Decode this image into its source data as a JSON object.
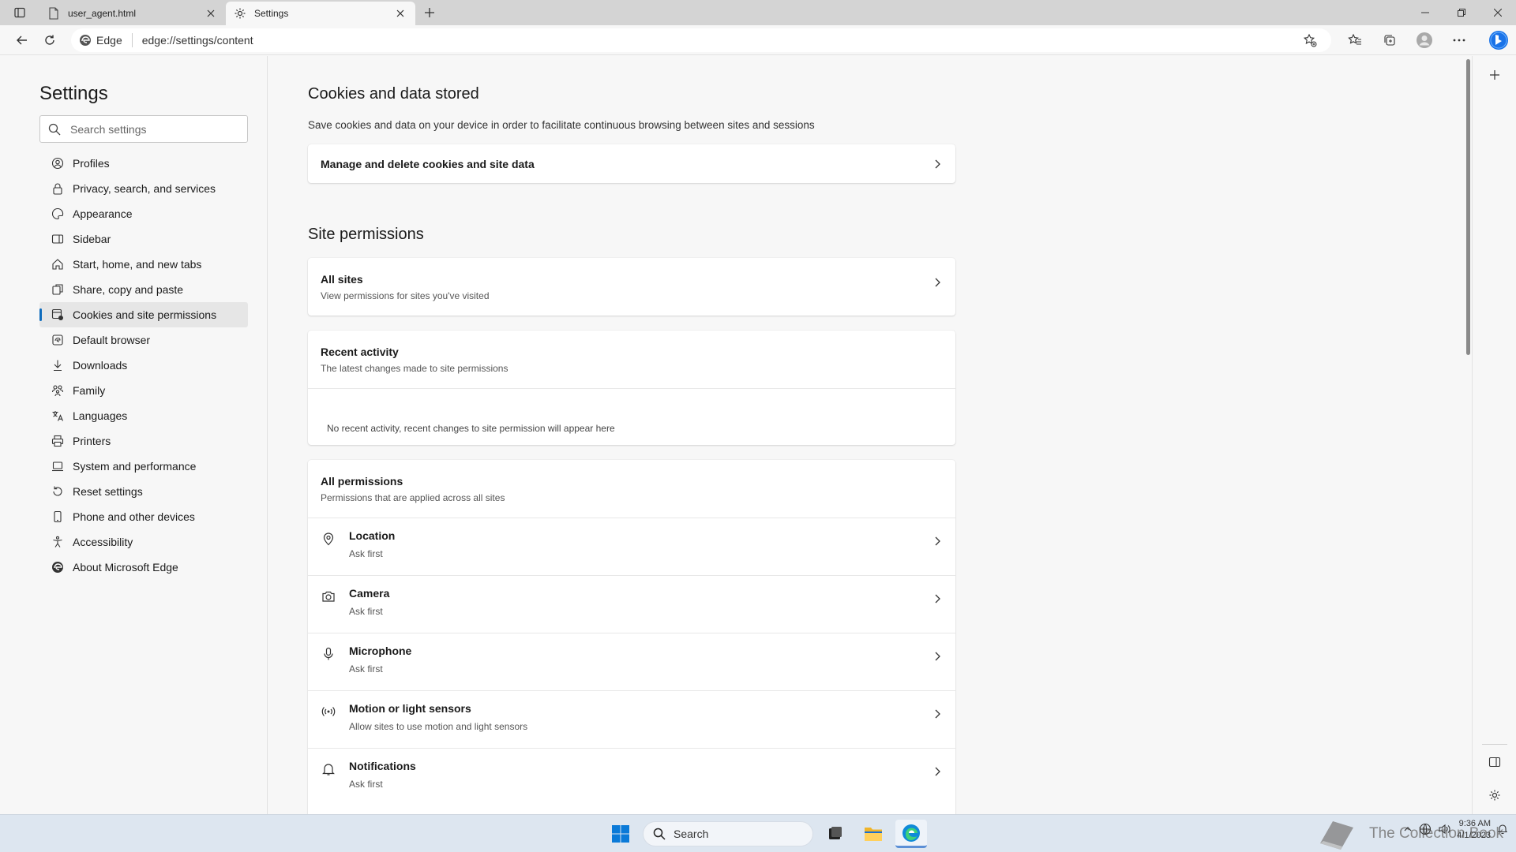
{
  "browser": {
    "tabs": [
      {
        "title": "user_agent.html",
        "icon": "file-icon"
      },
      {
        "title": "Settings",
        "icon": "gear-icon"
      }
    ],
    "edge_label": "Edge",
    "url": "edge://settings/content"
  },
  "sidebar": {
    "title": "Settings",
    "search_placeholder": "Search settings",
    "items": [
      {
        "label": "Profiles"
      },
      {
        "label": "Privacy, search, and services"
      },
      {
        "label": "Appearance"
      },
      {
        "label": "Sidebar"
      },
      {
        "label": "Start, home, and new tabs"
      },
      {
        "label": "Share, copy and paste"
      },
      {
        "label": "Cookies and site permissions"
      },
      {
        "label": "Default browser"
      },
      {
        "label": "Downloads"
      },
      {
        "label": "Family"
      },
      {
        "label": "Languages"
      },
      {
        "label": "Printers"
      },
      {
        "label": "System and performance"
      },
      {
        "label": "Reset settings"
      },
      {
        "label": "Phone and other devices"
      },
      {
        "label": "Accessibility"
      },
      {
        "label": "About Microsoft Edge"
      }
    ],
    "selected": "Cookies and site permissions"
  },
  "main": {
    "cookies": {
      "heading": "Cookies and data stored",
      "description": "Save cookies and data on your device in order to facilitate continuous browsing between sites and sessions",
      "manage_label": "Manage and delete cookies and site data"
    },
    "site_permissions": {
      "heading": "Site permissions",
      "all_sites": {
        "title": "All sites",
        "subtitle": "View permissions for sites you've visited"
      },
      "recent_activity": {
        "title": "Recent activity",
        "subtitle": "The latest changes made to site permissions",
        "empty": "No recent activity, recent changes to site permission will appear here"
      },
      "all_permissions": {
        "title": "All permissions",
        "subtitle": "Permissions that are applied across all sites",
        "items": [
          {
            "title": "Location",
            "subtitle": "Ask first",
            "icon": "location-icon"
          },
          {
            "title": "Camera",
            "subtitle": "Ask first",
            "icon": "camera-icon"
          },
          {
            "title": "Microphone",
            "subtitle": "Ask first",
            "icon": "microphone-icon"
          },
          {
            "title": "Motion or light sensors",
            "subtitle": "Allow sites to use motion and light sensors",
            "icon": "sensors-icon"
          },
          {
            "title": "Notifications",
            "subtitle": "Ask first",
            "icon": "bell-icon"
          }
        ]
      }
    }
  },
  "taskbar": {
    "search_label": "Search",
    "time": "9:36 AM",
    "date": "4/1/2023",
    "watermark": "The Collection Book"
  },
  "colors": {
    "accent": "#0f6cbd",
    "background": "#f7f7f7",
    "card": "#ffffff"
  }
}
